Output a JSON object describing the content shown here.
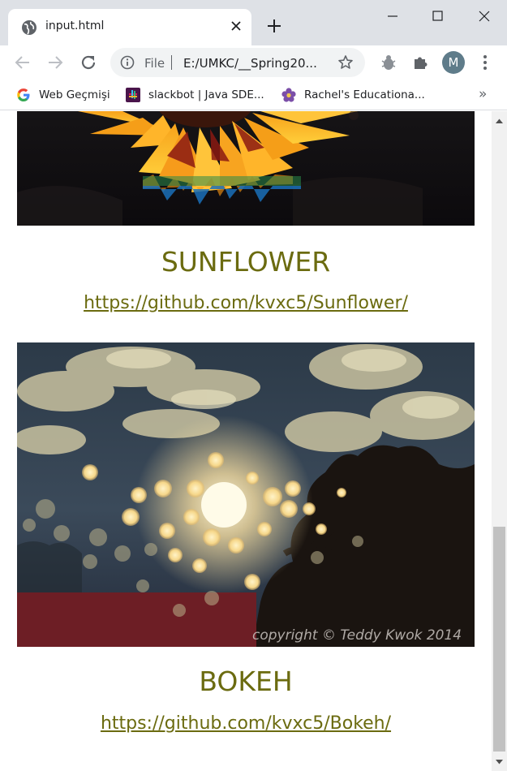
{
  "browser": {
    "tab_title": "input.html",
    "omnibox": {
      "scheme_label": "File",
      "url": "E:/UMKC/__Spring20..."
    },
    "avatar_letter": "M",
    "bookmarks": [
      {
        "label": "Web Geçmişi",
        "icon": "google-icon"
      },
      {
        "label": "slackbot | Java SDE...",
        "icon": "slack-icon"
      },
      {
        "label": "Rachel's Educationa...",
        "icon": "flower-icon"
      }
    ],
    "more_bookmarks": "»"
  },
  "page": {
    "items": [
      {
        "title": "SUNFLOWER",
        "link": "https://github.com/kvxc5/Sunflower/",
        "image": "sunflower-photo"
      },
      {
        "title": "BOKEH",
        "link": "https://github.com/kvxc5/Bokeh/",
        "image": "bokeh-photo",
        "watermark": "copyright © Teddy Kwok 2014"
      }
    ]
  },
  "colors": {
    "caption": "#6b6b10",
    "titlebar": "#dee1e6",
    "omnibox": "#f1f3f4"
  }
}
